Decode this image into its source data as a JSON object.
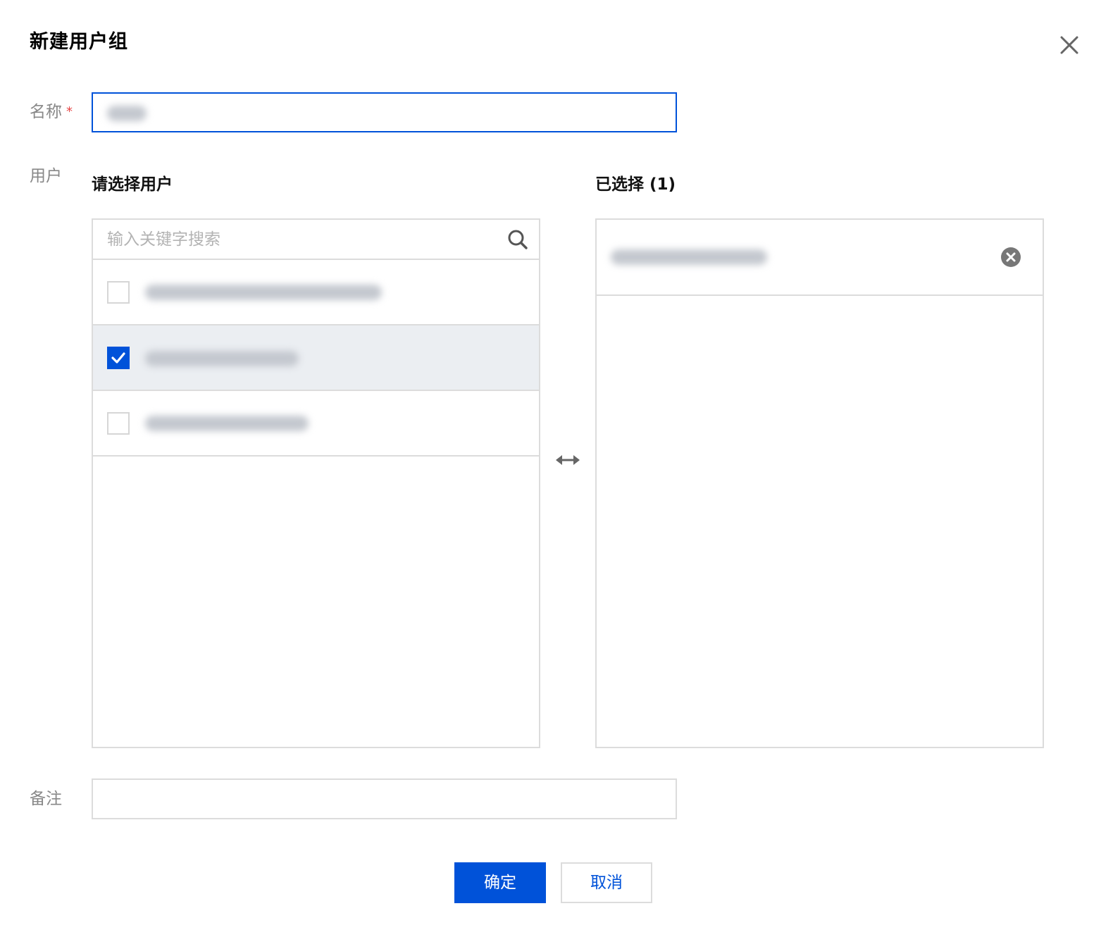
{
  "dialog": {
    "title": "新建用户组"
  },
  "form": {
    "name_label": "名称",
    "required_mark": "*",
    "users_label": "用户",
    "remark_label": "备注"
  },
  "transfer": {
    "source_title": "请选择用户",
    "search_placeholder": "输入关键字搜索",
    "target_title": "已选择 (1)",
    "items": [
      {
        "checked": false
      },
      {
        "checked": true
      },
      {
        "checked": false
      }
    ]
  },
  "buttons": {
    "confirm": "确定",
    "cancel": "取消"
  },
  "colors": {
    "primary": "#0052d9",
    "required": "#e54545",
    "selected_row_bg": "#ebeef2",
    "border": "#dcdcdc"
  }
}
